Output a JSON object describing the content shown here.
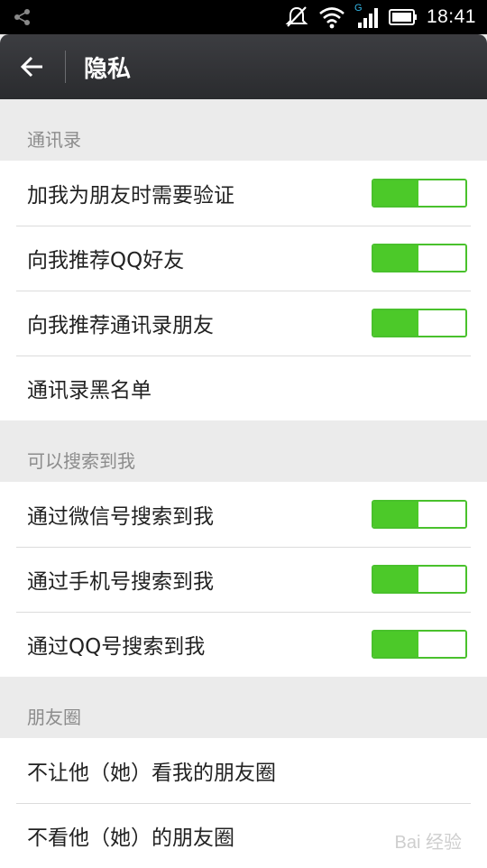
{
  "status_bar": {
    "time": "18:41",
    "network_label": "G",
    "icons": [
      "share-icon",
      "notifications-off-icon",
      "wifi-icon",
      "signal-icon",
      "battery-icon"
    ]
  },
  "action_bar": {
    "title": "隐私",
    "back_icon": "arrow-left-icon"
  },
  "sections": {
    "contacts": {
      "header": "通讯录",
      "items": [
        {
          "label": "加我为朋友时需要验证",
          "switch": true
        },
        {
          "label": "向我推荐QQ好友",
          "switch": true
        },
        {
          "label": "向我推荐通讯录朋友",
          "switch": true
        },
        {
          "label": "通讯录黑名单",
          "switch": null
        }
      ]
    },
    "search": {
      "header": "可以搜索到我",
      "items": [
        {
          "label": "通过微信号搜索到我",
          "switch": true
        },
        {
          "label": "通过手机号搜索到我",
          "switch": true
        },
        {
          "label": "通过QQ号搜索到我",
          "switch": true
        }
      ]
    },
    "moments": {
      "header": "朋友圈",
      "items": [
        {
          "label": "不让他（她）看我的朋友圈",
          "switch": null
        },
        {
          "label": "不看他（她）的朋友圈",
          "switch": null
        }
      ]
    }
  },
  "colors": {
    "accent_green": "#4cc929",
    "action_bar": "#2f3033",
    "background": "#ebebeb"
  },
  "watermark": "Bai 经验"
}
